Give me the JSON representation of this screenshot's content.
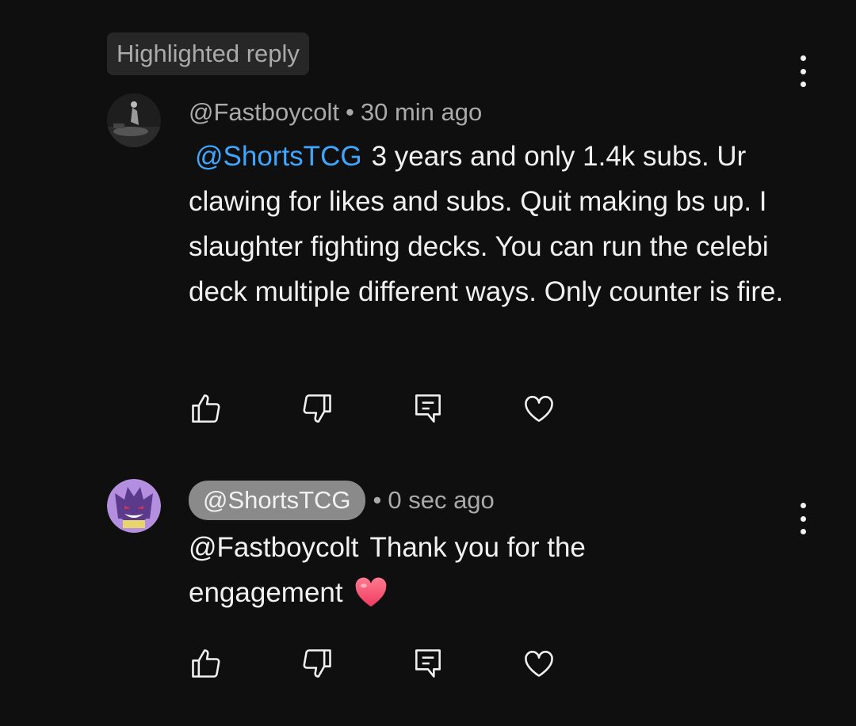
{
  "badge": "Highlighted reply",
  "comment1": {
    "handle": "@Fastboycolt",
    "separator": "•",
    "time": "30 min ago",
    "mention": "@ShortsTCG",
    "text": "3 years and only 1.4k subs. Ur clawing for likes and subs. Quit making bs up. I slaughter fighting decks. You can run the celebi deck multiple different ways. Only counter is fire."
  },
  "comment2": {
    "handle": "@ShortsTCG",
    "separator": "•",
    "time": "0 sec ago",
    "mention": "@Fastboycolt",
    "text": "Thank you for the engagement",
    "emoji": "heart"
  },
  "icons": [
    "like-icon",
    "dislike-icon",
    "reply-icon",
    "heart-icon",
    "more-options-icon"
  ],
  "colors": {
    "background": "#0f0f0f",
    "mention": "#3ea6ff",
    "heart": "#ff4e6a"
  }
}
